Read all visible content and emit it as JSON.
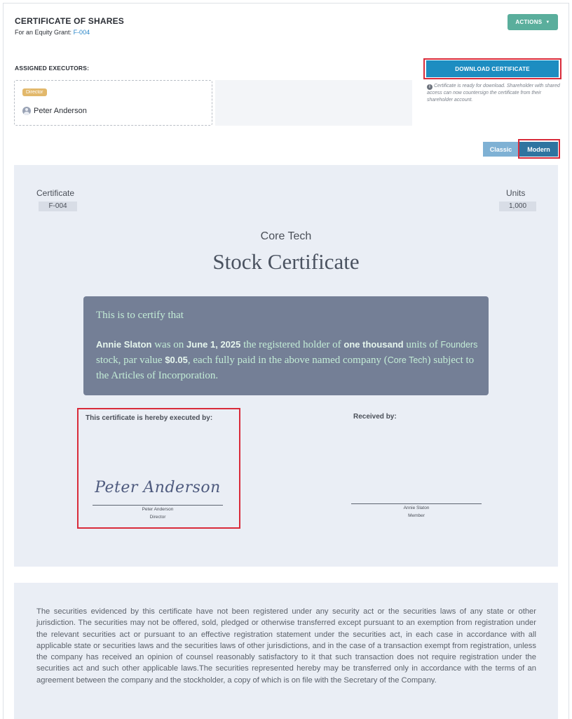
{
  "header": {
    "title": "CERTIFICATE OF SHARES",
    "grant_prefix": "For an Equity Grant:",
    "grant_id": "F-004",
    "actions_label": "ACTIONS"
  },
  "executors": {
    "label": "ASSIGNED EXECUTORS:",
    "items": [
      {
        "role": "Director",
        "name": "Peter Anderson"
      }
    ]
  },
  "download": {
    "label": "DOWNLOAD CERTIFICATE",
    "note": "Certificate is ready for download. Shareholder with shared access can now countersign the certificate from their shareholder account."
  },
  "style_toggle": {
    "options": [
      "Classic",
      "Modern"
    ],
    "selected": "Modern"
  },
  "certificate": {
    "number_label": "Certificate",
    "number": "F-004",
    "units_label": "Units",
    "units": "1,000",
    "company": "Core Tech",
    "title": "Stock Certificate",
    "intro": "This is to certify that",
    "holder": "Annie Slaton",
    "text_was_on": "was on",
    "date": "June 1, 2025",
    "text_registered": "the registered holder of",
    "units_words": "one thousand",
    "text_units_of": "units of",
    "class": "Founders",
    "text_stock_par": "stock, par value",
    "par_value": "$0.05",
    "text_paid": ", each fully paid in the above named company (",
    "company_ref": "Core Tech",
    "text_subject": ") subject to the Articles of Incorporation.",
    "executed_label": "This certificate is hereby executed by:",
    "received_label": "Received by:",
    "executor_signature": "Peter Anderson",
    "executor_name": "Peter Anderson",
    "executor_role": "Director",
    "receiver_name": "Annie Slaton",
    "receiver_role": "Member"
  },
  "legend": {
    "text": "The securities evidenced by this certificate have not been registered under any security act or the securities laws of any state or other jurisdiction. The securities may not be offered, sold, pledged or otherwise transferred except pursuant to an exemption from registration under the relevant securities act or pursuant to an effective registration statement under the securities act, in each case in accordance with all applicable state or securities laws and the securities laws of other jurisdictions, and in the case of a transaction exempt from registration, unless the company has received an opinion of counsel reasonably satisfactory to it that such transaction does not require registration under the securities act and such other applicable laws.The securities represented hereby may be transferred only in accordance with the terms of an agreement between the company and the stockholder, a copy of which is on file with the Secretary of the Company."
  },
  "colors": {
    "accent": "#1d8dc1",
    "actions": "#5aae9c",
    "highlight": "#d92b3a",
    "certify_box": "#747f96",
    "certify_text": "#c3ecd6"
  }
}
